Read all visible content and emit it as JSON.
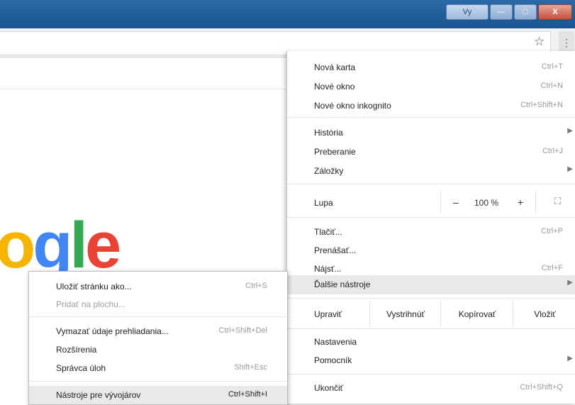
{
  "window": {
    "user_button": "Vy",
    "minimize": "—",
    "maximize": "□",
    "close": "X"
  },
  "toolbar": {
    "bookmark_icon": "star-icon",
    "menu_icon": "kebab-icon",
    "star_glyph": "☆",
    "kebab_glyph": "⋮"
  },
  "page": {
    "logo_fragment": [
      "o",
      "g",
      "l",
      "e"
    ],
    "logo_colors": [
      "#f4b400",
      "#4285f4",
      "#34a853",
      "#ea4335"
    ]
  },
  "menu": {
    "new_tab": {
      "label": "Nová karta",
      "shortcut": "Ctrl+T"
    },
    "new_window": {
      "label": "Nové okno",
      "shortcut": "Ctrl+N"
    },
    "incognito": {
      "label": "Nové okno inkognito",
      "shortcut": "Ctrl+Shift+N"
    },
    "history": {
      "label": "História",
      "arrow": "▶"
    },
    "downloads": {
      "label": "Preberanie",
      "shortcut": "Ctrl+J"
    },
    "bookmarks": {
      "label": "Záložky",
      "arrow": "▶"
    },
    "zoom": {
      "label": "Lupa",
      "minus": "–",
      "value": "100 %",
      "plus": "+",
      "fullscreen": "⛶"
    },
    "print": {
      "label": "Tlačiť...",
      "shortcut": "Ctrl+P"
    },
    "cast": {
      "label": "Prenášať..."
    },
    "find": {
      "label": "Nájsť...",
      "shortcut": "Ctrl+F"
    },
    "more_tools": {
      "label": "Ďalšie nástroje",
      "arrow": "▶"
    },
    "edit": {
      "label": "Upraviť",
      "cut": "Vystrihnúť",
      "copy": "Kopírovať",
      "paste": "Vložiť"
    },
    "settings": {
      "label": "Nastavenia"
    },
    "help": {
      "label": "Pomocník",
      "arrow": "▶"
    },
    "exit": {
      "label": "Ukončiť",
      "shortcut": "Ctrl+Shift+Q"
    }
  },
  "submenu": {
    "save_page": {
      "label": "Uložiť stránku ako...",
      "shortcut": "Ctrl+S"
    },
    "add_desktop": {
      "label": "Pridať na plochu..."
    },
    "clear_data": {
      "label": "Vymazať údaje prehliadania...",
      "shortcut": "Ctrl+Shift+Del"
    },
    "extensions": {
      "label": "Rozšírenia"
    },
    "task_manager": {
      "label": "Správca úloh",
      "shortcut": "Shift+Esc"
    },
    "dev_tools": {
      "label": "Nástroje pre vývojárov",
      "shortcut": "Ctrl+Shift+I"
    }
  }
}
